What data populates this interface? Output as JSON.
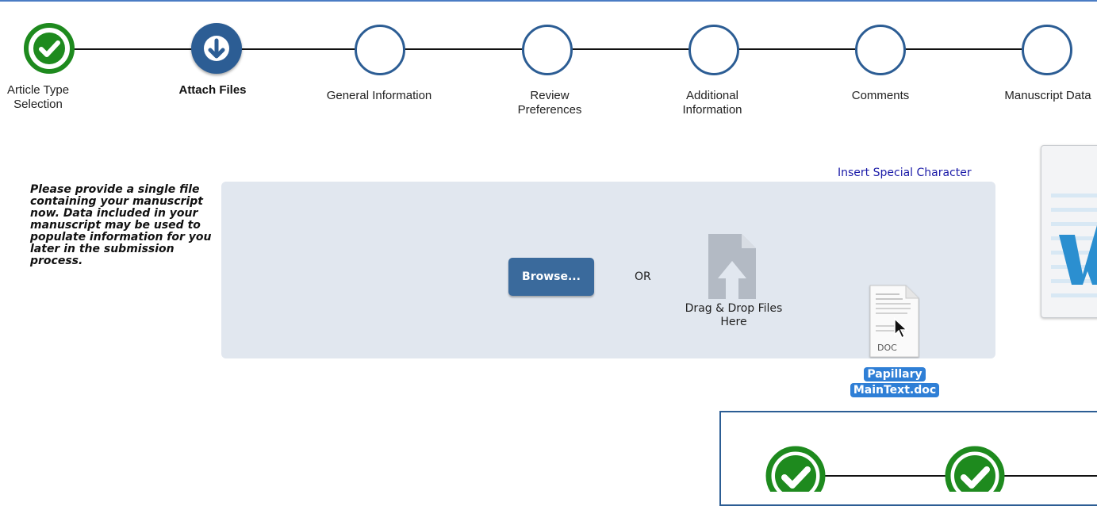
{
  "stepper": {
    "steps": [
      {
        "label": "Article Type Selection",
        "state": "done"
      },
      {
        "label": "Attach Files",
        "state": "current"
      },
      {
        "label": "General Information",
        "state": "pending"
      },
      {
        "label": "Review Preferences",
        "state": "pending"
      },
      {
        "label": "Additional Information",
        "state": "pending"
      },
      {
        "label": "Comments",
        "state": "pending"
      },
      {
        "label": "Manuscript Data",
        "state": "pending"
      }
    ]
  },
  "instructions": "Please provide a single file containing your manuscript now. Data included in your manuscript may be used to populate information for you later in the submission process.",
  "insert_special_character": "Insert Special Character",
  "upload": {
    "browse_label": "Browse...",
    "or_label": "OR",
    "drop_label": "Drag & Drop Files Here"
  },
  "dragged_file": {
    "name": "Papillary MainText.doc",
    "extension": "DOC"
  },
  "colors": {
    "accent": "#2c5d94",
    "done": "#1e8a1e",
    "dropzone": "#e1e7ef",
    "link": "#1a1aa8",
    "selection": "#2f7fd6"
  }
}
